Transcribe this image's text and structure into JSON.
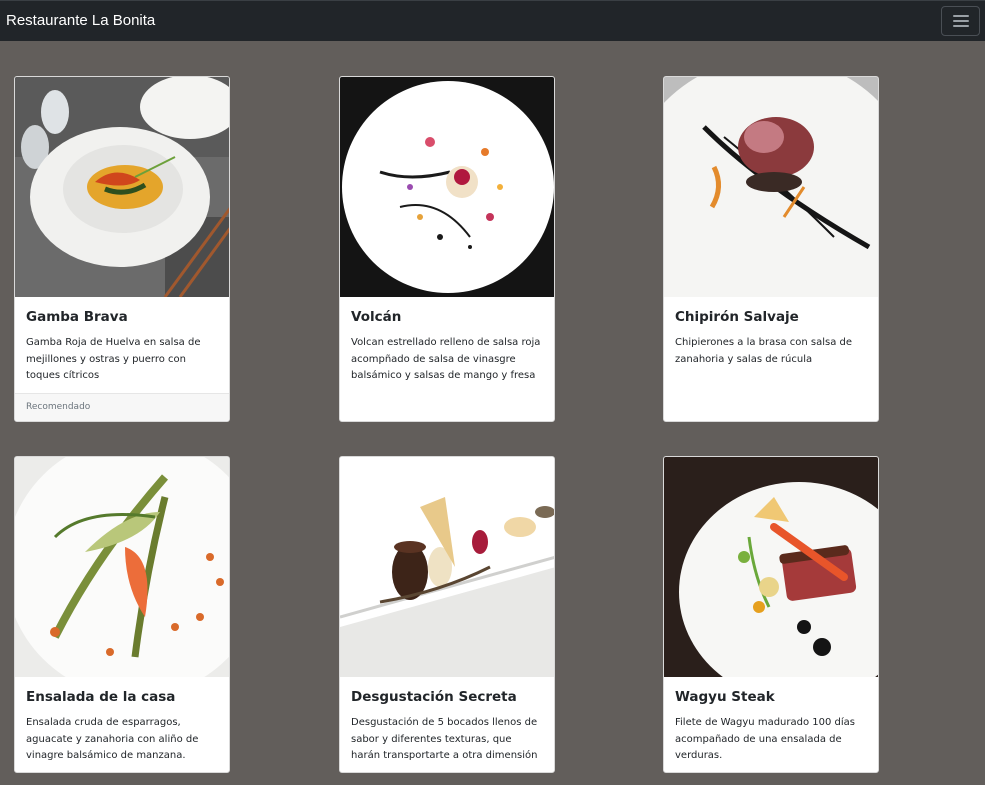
{
  "navbar": {
    "brand": "Restaurante La Bonita",
    "toggler_icon": "hamburger-menu-icon"
  },
  "cards": [
    {
      "title": "Gamba Brava",
      "text": "Gamba Roja de Huelva en salsa de mejillones y ostras y puerro con toques cítricos",
      "footer": "Recomendado",
      "image": "dish-gamba-brava-photo"
    },
    {
      "title": "Volcán",
      "text": "Volcan estrellado relleno de salsa roja acompñado de salsa de vinasgre balsámico y salsas de mango y fresa",
      "image": "dish-volcan-photo"
    },
    {
      "title": "Chipirón Salvaje",
      "text": "Chipierones a la brasa con salsa de zanahoria y salas de rúcula",
      "image": "dish-chipiron-photo"
    },
    {
      "title": "Ensalada de la casa",
      "text": "Ensalada cruda de esparragos, aguacate y zanahoria con aliño de vinagre balsámico de manzana.",
      "image": "dish-ensalada-photo"
    },
    {
      "title": "Desgustación Secreta",
      "text": "Desgustación de 5 bocados llenos de sabor y diferentes texturas, que harán transportarte a otra dimensión",
      "image": "dish-degustacion-photo"
    },
    {
      "title": "Wagyu Steak",
      "text": "Filete de Wagyu madurado 100 días acompañado de una ensalada de verduras.",
      "image": "dish-wagyu-photo"
    }
  ]
}
